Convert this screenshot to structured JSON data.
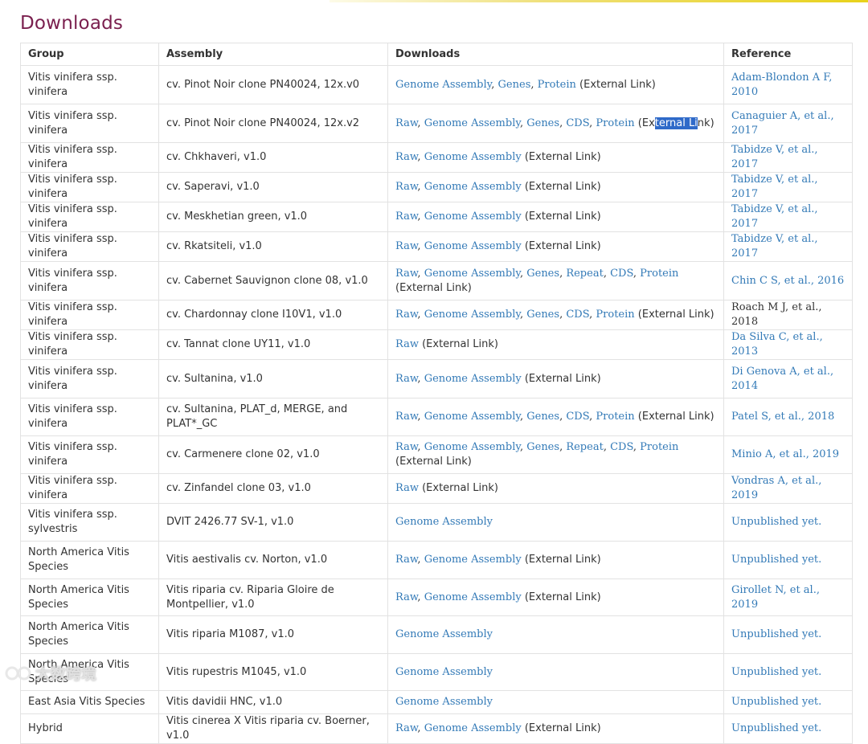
{
  "page": {
    "title": "Downloads"
  },
  "table": {
    "headers": [
      "Group",
      "Assembly",
      "Downloads",
      "Reference"
    ],
    "rows": [
      {
        "group": "Vitis vinifera ssp. vinifera",
        "assembly": "cv. Pinot Noir clone PN40024, 12x.v0",
        "links": [
          "Genome Assembly",
          "Genes",
          "Protein"
        ],
        "ext": "(External Link)",
        "ref": "Adam-Blondon A F, 2010",
        "h": 48
      },
      {
        "group": "Vitis vinifera ssp. vinifera",
        "assembly": "cv. Pinot Noir clone PN40024, 12x.v2",
        "links": [
          "Raw",
          "Genome Assembly",
          "Genes",
          "CDS",
          "Protein"
        ],
        "ext": "(External Link)",
        "ref": "Canaguier A, et al., 2017",
        "h": 48
      },
      {
        "group": "Vitis vinifera ssp. vinifera",
        "assembly": "cv. Chkhaveri, v1.0",
        "links": [
          "Raw",
          "Genome Assembly"
        ],
        "ext": "(External Link)",
        "ref": "Tabidze V, et al., 2017",
        "h": 29
      },
      {
        "group": "Vitis vinifera ssp. vinifera",
        "assembly": "cv. Saperavi, v1.0",
        "links": [
          "Raw",
          "Genome Assembly"
        ],
        "ext": "(External Link)",
        "ref": "Tabidze V, et al., 2017",
        "h": 29
      },
      {
        "group": "Vitis vinifera ssp. vinifera",
        "assembly": "cv. Meskhetian green, v1.0",
        "links": [
          "Raw",
          "Genome Assembly"
        ],
        "ext": "(External Link)",
        "ref": "Tabidze V, et al., 2017",
        "h": 29
      },
      {
        "group": "Vitis vinifera ssp. vinifera",
        "assembly": "cv. Rkatsiteli, v1.0",
        "links": [
          "Raw",
          "Genome Assembly"
        ],
        "ext": "(External Link)",
        "ref": "Tabidze V, et al., 2017",
        "h": 29
      },
      {
        "group": "Vitis vinifera ssp. vinifera",
        "assembly": "cv. Cabernet Sauvignon clone 08, v1.0",
        "links": [
          "Raw",
          "Genome Assembly",
          "Genes",
          "Repeat",
          "CDS",
          "Protein"
        ],
        "ext": "(External Link)",
        "ref": "Chin C S, et al., 2016",
        "h": 48
      },
      {
        "group": "Vitis vinifera ssp. vinifera",
        "assembly": "cv. Chardonnay clone I10V1, v1.0",
        "links": [
          "Raw",
          "Genome Assembly",
          "Genes",
          "CDS",
          "Protein"
        ],
        "ext": "(External Link)",
        "ref": "Roach M J, et al., 2018",
        "h": 29
      },
      {
        "group": "Vitis vinifera ssp. vinifera",
        "assembly": "cv. Tannat clone UY11, v1.0",
        "links": [
          "Raw"
        ],
        "ext": "(External Link)",
        "ref": "Da Silva C, et al., 2013",
        "h": 29
      },
      {
        "group": "Vitis vinifera ssp. vinifera",
        "assembly": "cv. Sultanina, v1.0",
        "links": [
          "Raw",
          "Genome Assembly"
        ],
        "ext": "(External Link)",
        "ref": "Di Genova A, et al., 2014",
        "h": 48
      },
      {
        "group": "Vitis vinifera ssp. vinifera",
        "assembly": "cv. Sultanina, PLAT_d, MERGE, and PLAT*_GC",
        "links": [
          "Raw",
          "Genome Assembly",
          "Genes",
          "CDS",
          "Protein"
        ],
        "ext": "(External Link)",
        "ref": "Patel S, et al., 2018",
        "h": 47
      },
      {
        "group": "Vitis vinifera ssp. vinifera",
        "assembly": "cv. Carmenere clone 02, v1.0",
        "links": [
          "Raw",
          "Genome Assembly",
          "Genes",
          "Repeat",
          "CDS",
          "Protein"
        ],
        "ext": "(External Link)",
        "ref": "Minio A, et al., 2019",
        "h": 47
      },
      {
        "group": "Vitis vinifera ssp. vinifera",
        "assembly": "cv. Zinfandel clone 03, v1.0",
        "links": [
          "Raw"
        ],
        "ext": "(External Link)",
        "ref": "Vondras A, et al., 2019",
        "h": 29
      },
      {
        "group": "Vitis vinifera ssp. sylvestris",
        "assembly": "DVIT 2426.77 SV-1, v1.0",
        "links": [
          "Genome Assembly"
        ],
        "ext": "",
        "ref": "Unpublished yet.",
        "h": 47
      },
      {
        "group": "North America Vitis Species",
        "assembly": "Vitis aestivalis cv. Norton, v1.0",
        "links": [
          "Raw",
          "Genome Assembly"
        ],
        "ext": "(External Link)",
        "ref": "Unpublished yet.",
        "h": 47
      },
      {
        "group": "North America Vitis Species",
        "assembly": "Vitis riparia cv. Riparia Gloire de Montpellier, v1.0",
        "links": [
          "Raw",
          "Genome Assembly"
        ],
        "ext": "(External Link)",
        "ref": "Girollet N, et al., 2019",
        "h": 46
      },
      {
        "group": "North America Vitis Species",
        "assembly": "Vitis riparia M1087, v1.0",
        "links": [
          "Genome Assembly"
        ],
        "ext": "",
        "ref": "Unpublished yet.",
        "h": 47
      },
      {
        "group": "North America Vitis Species",
        "assembly": "Vitis rupestris M1045, v1.0",
        "links": [
          "Genome Assembly"
        ],
        "ext": "",
        "ref": "Unpublished yet.",
        "h": 46
      },
      {
        "group": "East Asia Vitis Species",
        "assembly": "Vitis davidii HNC, v1.0",
        "links": [
          "Genome Assembly"
        ],
        "ext": "",
        "ref": "Unpublished yet.",
        "h": 29
      },
      {
        "group": "Hybrid",
        "assembly": "Vitis cinerea X Vitis riparia cv. Boerner, v1.0",
        "links": [
          "Raw",
          "Genome Assembly"
        ],
        "ext": "(External Link)",
        "ref": "Unpublished yet.",
        "h": 29
      }
    ]
  },
  "selection": {
    "row": 1,
    "before": "(Ex",
    "selected": "ternal Li",
    "after": "nk)"
  },
  "plain_ref_rows": [
    7
  ],
  "watermark": {
    "text": "大数跨境"
  },
  "colors": {
    "link": "#337ab7",
    "title": "#7a1f4e",
    "border": "#e2e2e2",
    "selection": "#2f6ac9"
  }
}
